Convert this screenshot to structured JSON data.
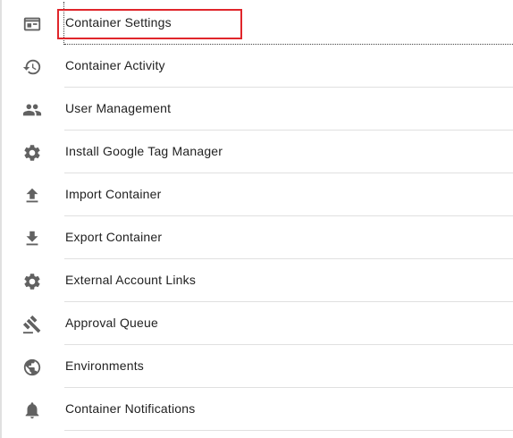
{
  "menu": {
    "items": [
      {
        "label": "Container Settings",
        "icon": "container-settings-icon"
      },
      {
        "label": "Container Activity",
        "icon": "history-icon"
      },
      {
        "label": "User Management",
        "icon": "people-icon"
      },
      {
        "label": "Install Google Tag Manager",
        "icon": "gear-icon"
      },
      {
        "label": "Import Container",
        "icon": "upload-icon"
      },
      {
        "label": "Export Container",
        "icon": "download-icon"
      },
      {
        "label": "External Account Links",
        "icon": "gear-icon"
      },
      {
        "label": "Approval Queue",
        "icon": "gavel-icon"
      },
      {
        "label": "Environments",
        "icon": "globe-icon"
      },
      {
        "label": "Container Notifications",
        "icon": "bell-icon"
      }
    ]
  },
  "colors": {
    "highlight": "#e0262b",
    "icon": "#616161",
    "divider": "#e0e0e0"
  }
}
